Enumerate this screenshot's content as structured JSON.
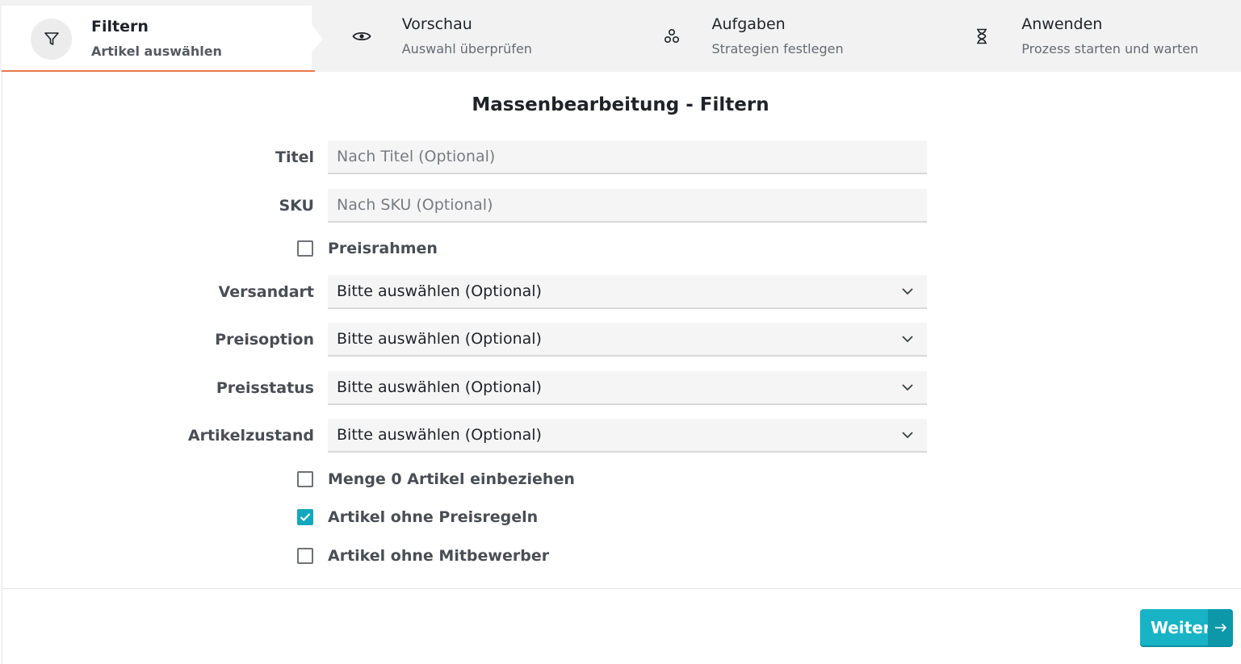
{
  "stepper": {
    "steps": [
      {
        "title": "Filtern",
        "subtitle": "Artikel auswählen",
        "icon": "filter-icon",
        "active": true
      },
      {
        "title": "Vorschau",
        "subtitle": "Auswahl überprüfen",
        "icon": "eye-icon",
        "active": false
      },
      {
        "title": "Aufgaben",
        "subtitle": "Strategien festlegen",
        "icon": "tasks-icon",
        "active": false
      },
      {
        "title": "Anwenden",
        "subtitle": "Prozess starten und warten",
        "icon": "hourglass-icon",
        "active": false
      }
    ]
  },
  "form": {
    "title": "Massenbearbeitung - Filtern",
    "title_field": {
      "label": "Titel",
      "value": "",
      "placeholder": "Nach Titel (Optional)"
    },
    "sku_field": {
      "label": "SKU",
      "value": "",
      "placeholder": "Nach SKU (Optional)"
    },
    "price_range": {
      "label": "Preisrahmen",
      "checked": false
    },
    "shipping": {
      "label": "Versandart",
      "value": "Bitte auswählen (Optional)"
    },
    "price_option": {
      "label": "Preisoption",
      "value": "Bitte auswählen (Optional)"
    },
    "price_status": {
      "label": "Preisstatus",
      "value": "Bitte auswählen (Optional)"
    },
    "condition": {
      "label": "Artikelzustand",
      "value": "Bitte auswählen (Optional)"
    },
    "include_zero": {
      "label": "Menge 0 Artikel einbeziehen",
      "checked": false
    },
    "no_price_rules": {
      "label": "Artikel ohne Preisregeln",
      "checked": true
    },
    "no_competitors": {
      "label": "Artikel ohne Mitbewerber",
      "checked": false
    }
  },
  "footer": {
    "next_label": "Weiter"
  },
  "colors": {
    "accent": "#18b3c5",
    "active_underline": "#e8794b",
    "checkbox_checked": "#13a7bd"
  }
}
